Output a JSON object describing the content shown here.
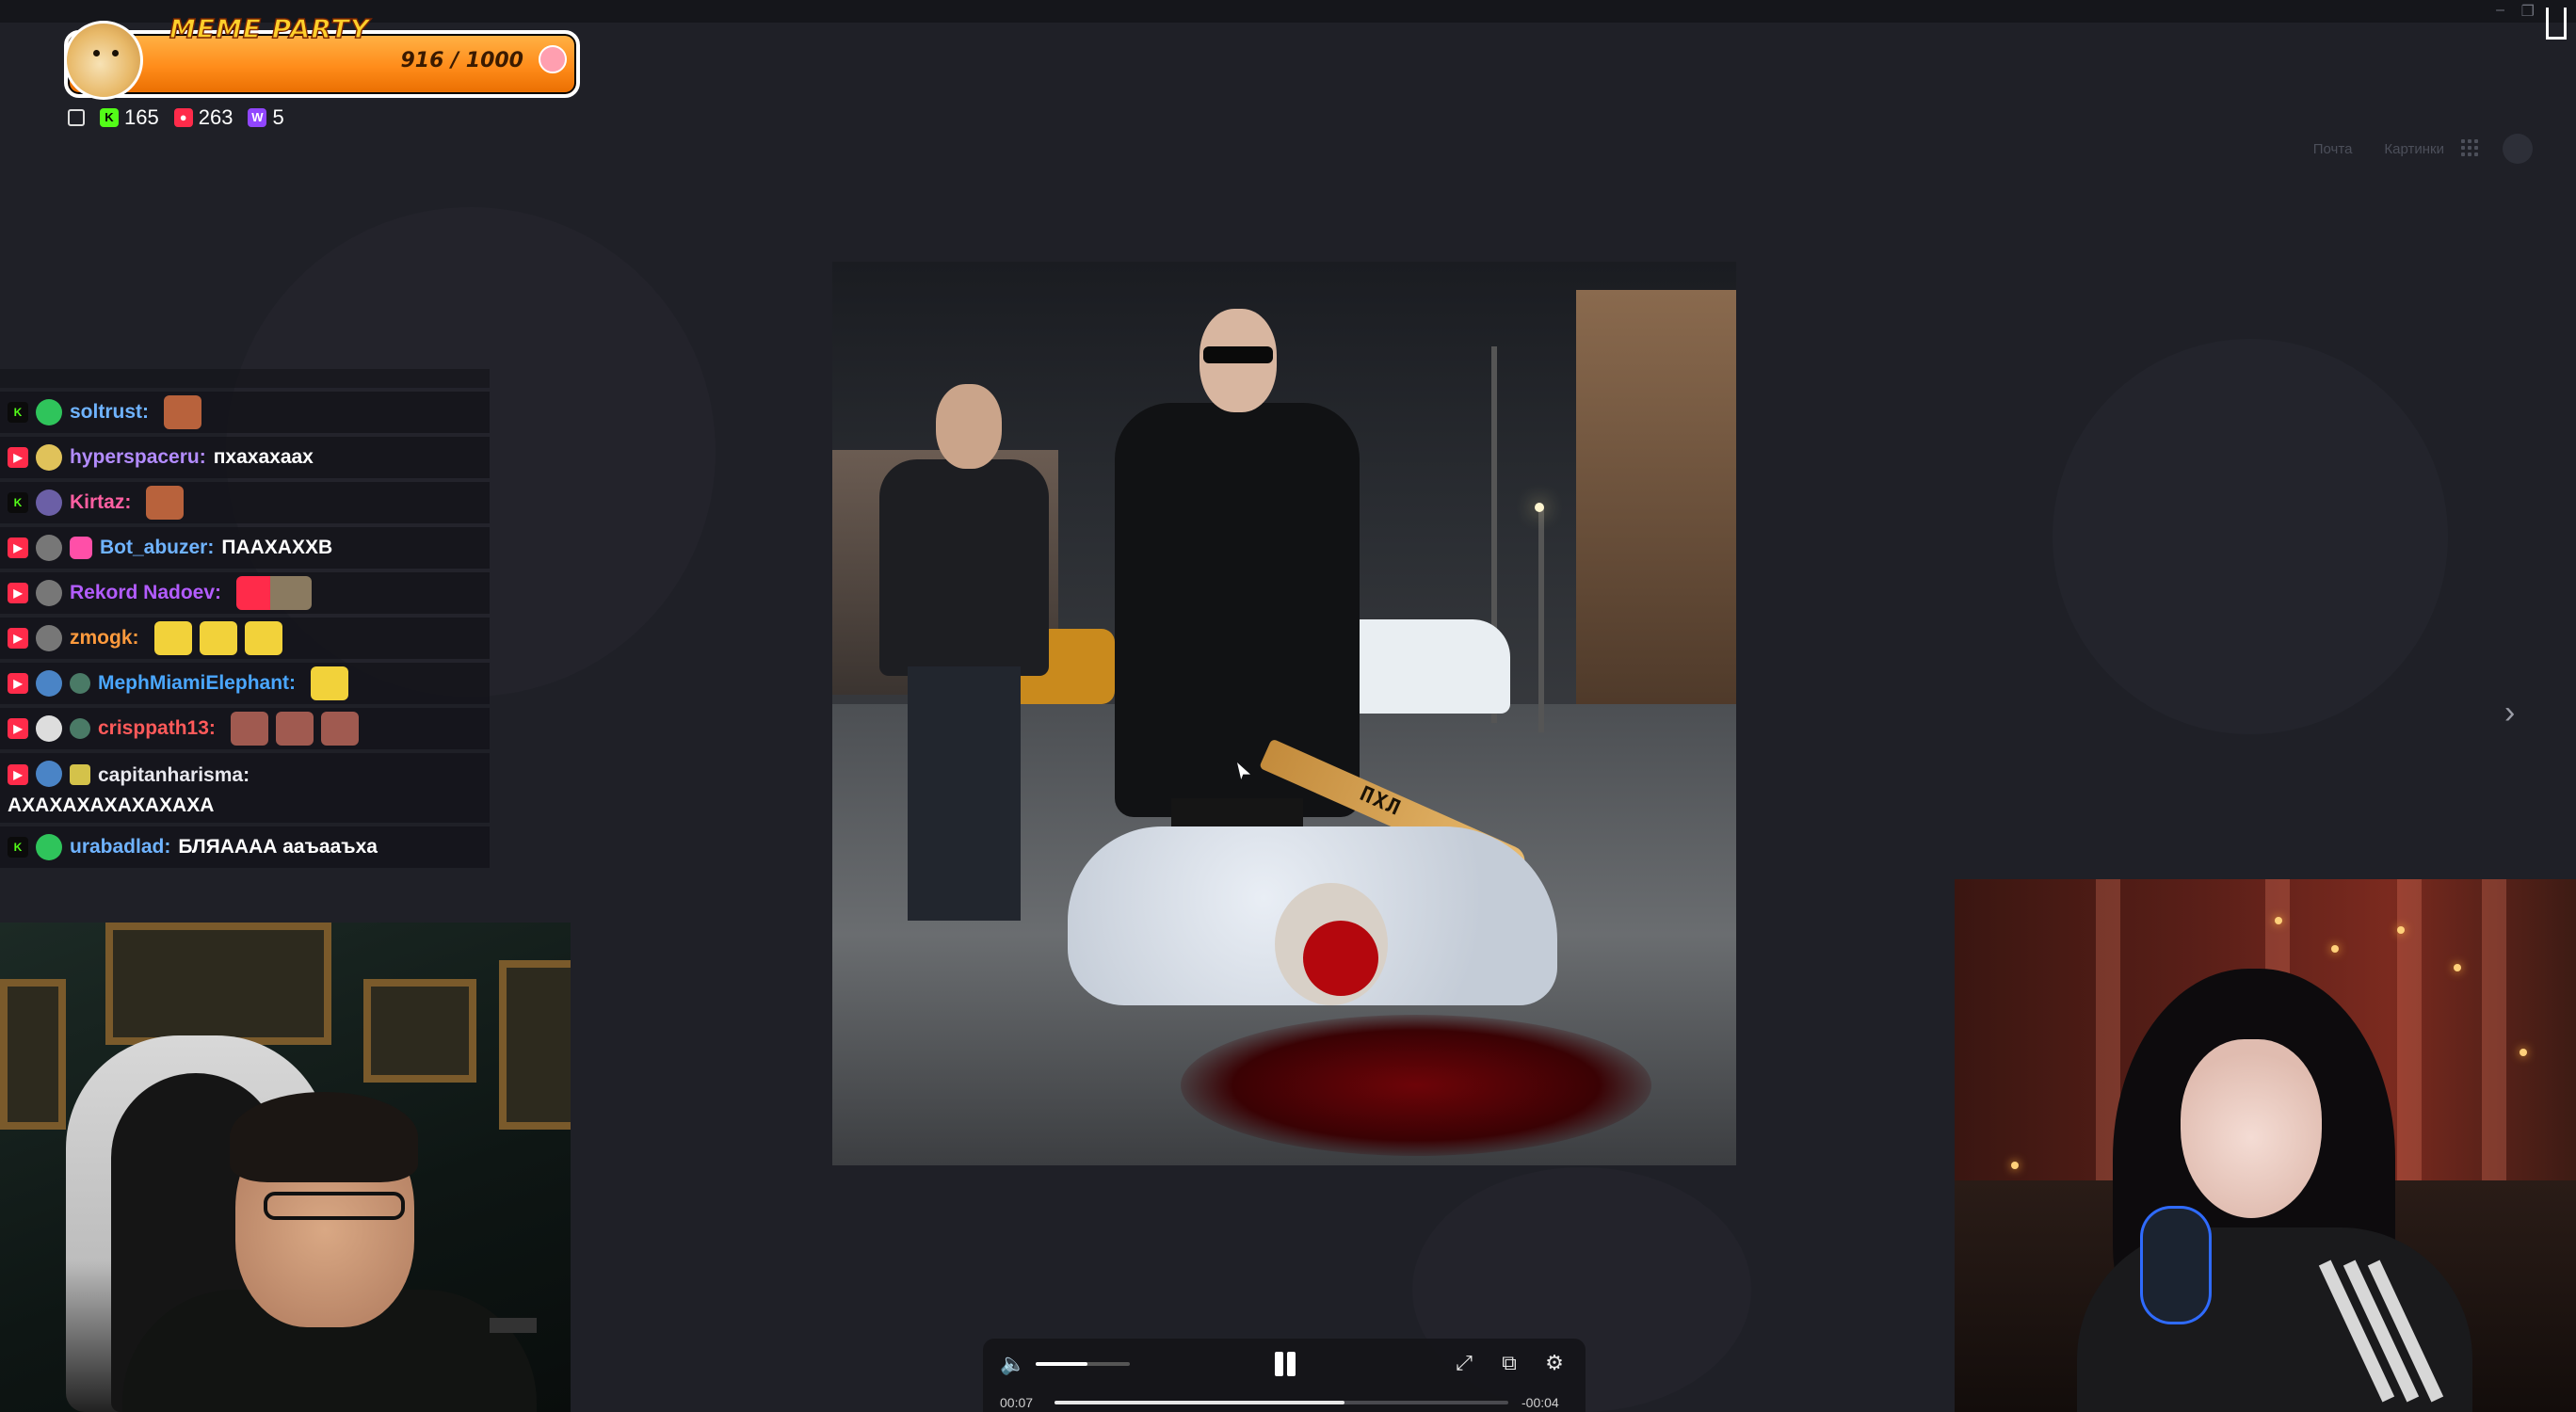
{
  "browser": {
    "tabs": [
      "",
      "",
      "",
      "",
      "",
      ""
    ],
    "bookmarks": [
      "",
      "",
      "",
      "",
      "",
      "",
      "",
      "",
      "",
      "",
      ""
    ],
    "top_links": [
      "Почта",
      "Картинки"
    ]
  },
  "widget": {
    "title": "MEME PARTY",
    "score": "916 / 1000",
    "score_value": 916,
    "score_max": 1000,
    "accent": "#ff8c1a"
  },
  "counts": {
    "kick": "165",
    "vk": "263",
    "twitch": "5"
  },
  "chat": [
    {
      "platform": "kick",
      "user": "soltrust:",
      "user_color": "#6fb3ff",
      "message": "",
      "badge_color": "#2fc45b",
      "emotes": 1
    },
    {
      "platform": "vk",
      "user": "hyperspaceru:",
      "user_color": "#b38cff",
      "message": "пхахахаах",
      "badge_color": "#e0c25a",
      "emotes": 0
    },
    {
      "platform": "kick",
      "user": "Kirtaz:",
      "user_color": "#ff5fa2",
      "message": "",
      "badge_color": "#6b5fa6",
      "emotes": 1
    },
    {
      "platform": "vk",
      "user": "Bot_abuzer:",
      "user_color": "#6fb3ff",
      "message": "ПААХАХХВ",
      "badge_color": "#ff4fa8",
      "emotes": 0
    },
    {
      "platform": "vk",
      "user": "Rekord Nadoev:",
      "user_color": "#b35cff",
      "message": "",
      "badge_color": "#777777",
      "emotes": 1
    },
    {
      "platform": "vk",
      "user": "zmogk:",
      "user_color": "#ff9a3d",
      "message": "",
      "badge_color": "#777777",
      "emotes": 3
    },
    {
      "platform": "vk",
      "user": "MephMiamiElephant:",
      "user_color": "#4aa7ff",
      "message": "",
      "badge_color": "#4a84c6",
      "emotes": 1
    },
    {
      "platform": "vk",
      "user": "crisppath13:",
      "user_color": "#ff5a5a",
      "message": "",
      "badge_color": "#dddddd",
      "emotes": 3
    },
    {
      "platform": "vk",
      "user": "capitanharisma:",
      "user_color": "#e8e8ee",
      "message": "АХАХАХАХАХАХАХА",
      "badge_color": "#4a84c6",
      "emotes": 0
    },
    {
      "platform": "kick",
      "user": "urabadlad:",
      "user_color": "#6fb3ff",
      "message": "БЛЯАААА ааъааъха",
      "badge_color": "#2fc45b",
      "emotes": 0
    }
  ],
  "meme": {
    "bat_text": "ПХЛ"
  },
  "player": {
    "current_time": "00:07",
    "remaining_time": "-00:04",
    "progress": 0.64,
    "volume": 0.55
  },
  "icons": {
    "volume": "volume-icon",
    "pause": "pause-icon",
    "fullscreen": "fullscreen-icon",
    "pip": "picture-in-picture-icon",
    "settings": "settings-icon",
    "next": "chevron-right-icon"
  }
}
